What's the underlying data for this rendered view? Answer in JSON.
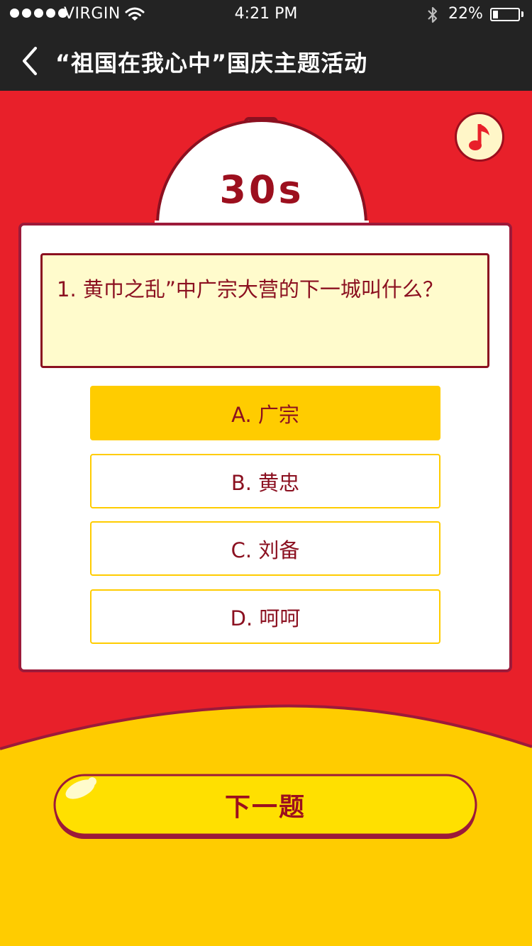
{
  "status_bar": {
    "carrier": "VIRGIN",
    "time": "4:21 PM",
    "battery_percent": "22%",
    "battery_level": 0.22
  },
  "nav": {
    "title": "“祖国在我心中”国庆主题活动",
    "back_icon": "chevron-left-icon"
  },
  "colors": {
    "red_background": "#E8202A",
    "yellow": "#FFCC00",
    "dark_red": "#9C0F1E",
    "question_bg": "#FFFBCC",
    "topbar": "#232323"
  },
  "timer": {
    "label": "30s",
    "icon": "stopwatch-icon"
  },
  "music_button": {
    "icon": "music-note-icon"
  },
  "question": {
    "text": "1. 黄巾之乱”中广宗大营的下一城叫什么？"
  },
  "options": [
    {
      "label": "A. 广宗",
      "selected": true
    },
    {
      "label": "B. 黄忠",
      "selected": false
    },
    {
      "label": "C. 刘备",
      "selected": false
    },
    {
      "label": "D. 呵呵",
      "selected": false
    }
  ],
  "next_button": {
    "label": "下一题"
  }
}
